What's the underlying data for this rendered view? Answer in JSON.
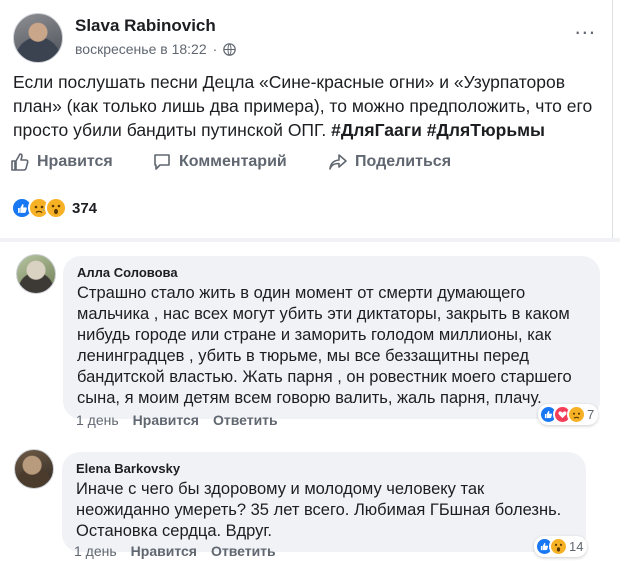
{
  "post": {
    "author": "Slava Rabinovich",
    "timestamp": "воскресенье в 18:22",
    "privacy_icon": "globe-icon",
    "more_label": "...",
    "text_before_tags": "Если послушать песни Децла «Сине-красные огни» и «Узурпаторов план» (как только лишь два примера), то можно предположить, что его просто убили бандиты путинской ОПГ.",
    "hashtags": [
      "#ДляГааги",
      "#ДляТюрьмы"
    ],
    "actions": {
      "like": "Нравится",
      "comment": "Комментарий",
      "share": "Поделиться"
    },
    "reactions": [
      "like",
      "sad",
      "wow"
    ],
    "reaction_count": "374"
  },
  "comments": [
    {
      "author": "Алла Соловова",
      "text": "Страшно стало жить в один момент от смерти думающего мальчика , нас всех могут убить эти диктаторы, закрыть в каком нибудь городе или стране и заморить голодом миллионы, как ленинградцев , убить в тюрьме, мы все беззащитны перед бандитской властью. Жать парня , он ровестник моего старшего сына, я моим детям всем говорю валить, жаль парня, плачу.",
      "time": "1 день",
      "like": "Нравится",
      "reply": "Ответить",
      "reactions": [
        "like",
        "love",
        "sad"
      ],
      "reaction_count": "7"
    },
    {
      "author": "Elena Barkovsky",
      "text": "Иначе с чего бы здоровому и молодому человеку так неожиданно умереть? 35 лет всего. Любимая ГБшная болезнь. Остановка сердца. Вдруг.",
      "time": "1 день",
      "like": "Нравится",
      "reply": "Ответить",
      "reactions": [
        "like",
        "wow"
      ],
      "reaction_count": "14"
    }
  ],
  "colors": {
    "like_blue": "#1877f2",
    "secondary_text": "#606770",
    "bubble_bg": "#f0f2f5"
  }
}
